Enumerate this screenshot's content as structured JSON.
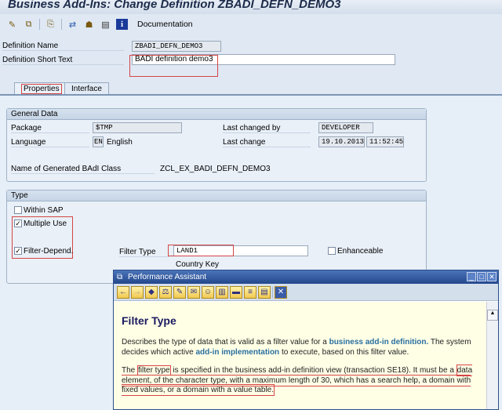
{
  "title": "Business Add-Ins: Change Definition ZBADI_DEFN_DEMO3",
  "toolbar": {
    "icons": [
      "edit-icon",
      "copy-icon",
      "display-object-icon",
      "navigate-icon",
      "hierarchy-icon",
      "print-icon",
      "info-icon"
    ],
    "documentation_label": "Documentation"
  },
  "header": {
    "def_name_label": "Definition Name",
    "def_name_value": "ZBADI_DEFN_DEMO3",
    "short_text_label": "Definition Short Text",
    "short_text_value": "BADI definition demo3"
  },
  "tabs": [
    {
      "label": "Properties"
    },
    {
      "label": "Interface"
    }
  ],
  "general": {
    "title": "General Data",
    "package_label": "Package",
    "package_value": "$TMP",
    "language_label": "Language",
    "language_code": "EN",
    "language_name": "English",
    "changed_by_label": "Last changed by",
    "changed_by_value": "DEVELOPER",
    "last_change_label": "Last change",
    "last_change_date": "19.10.2013",
    "last_change_time": "11:52:45",
    "class_label": "Name of Generated BAdI Class",
    "class_value": "ZCL_EX_BADI_DEFN_DEMO3"
  },
  "type": {
    "title": "Type",
    "within_sap": "Within SAP",
    "multiple_use": "Multiple Use",
    "filter_depend": "Filter-Depend.",
    "filter_type_label": "Filter Type",
    "filter_type_value": "LAND1",
    "filter_type_desc": "Country Key",
    "enhanceable": "Enhanceable",
    "check": "✓"
  },
  "assistant": {
    "title": "Performance Assistant",
    "heading": "Filter Type",
    "p1a": "Describes the type of data that is valid as a filter value for a ",
    "p1link1": "business add-in definition.",
    "p1b": "  The system decides which active ",
    "p1link2": "add-in implementation",
    "p1c": " to execute, based on this filter value.",
    "p2a": "The ",
    "p2hl": "filter type",
    "p2b": " is specified in the business add-in definition view (transaction SE18). It must be a ",
    "p2c": "data element, of the character type, with a maximum length of 30, which has a search help, a domain with fixed values, or a domain with a value table."
  }
}
